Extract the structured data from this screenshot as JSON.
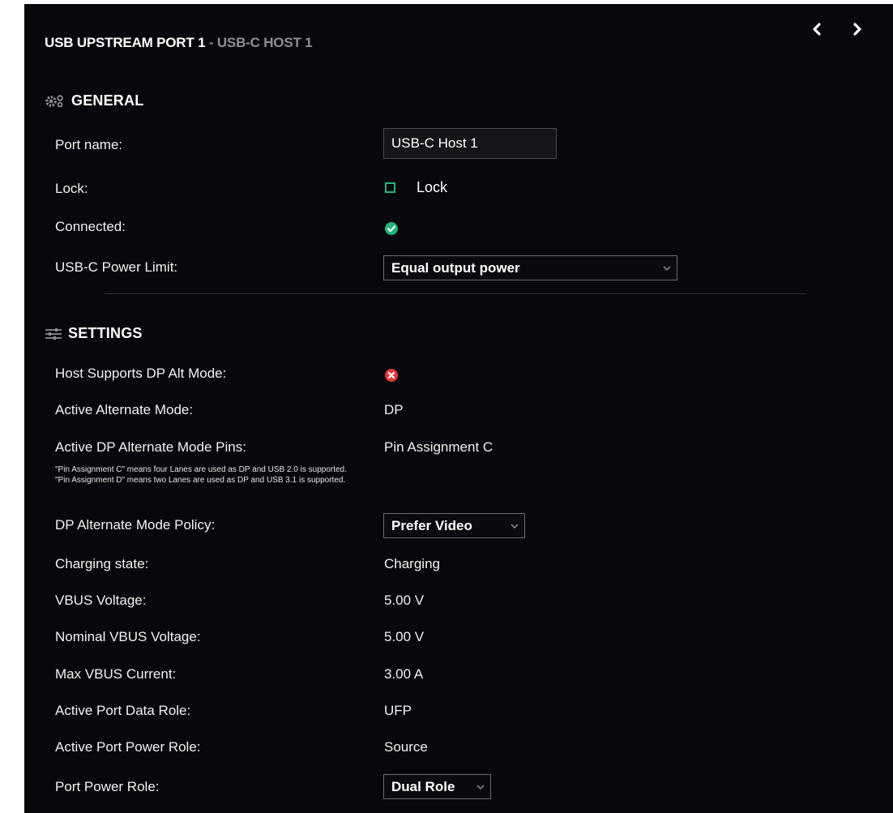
{
  "header": {
    "title": "USB UPSTREAM PORT 1",
    "separator": " - ",
    "subtitle": "USB-C HOST 1",
    "prev_icon": "chevron-left-icon",
    "next_icon": "chevron-right-icon"
  },
  "general": {
    "heading": "GENERAL",
    "icon": "gears-icon",
    "port_name_label": "Port name:",
    "port_name_value": "USB-C Host 1",
    "lock_label": "Lock:",
    "lock_checkbox_label": "Lock",
    "lock_checked": false,
    "connected_label": "Connected:",
    "connected_icon": "check-circle-icon",
    "power_limit_label": "USB-C Power Limit:",
    "power_limit_value": "Equal output power"
  },
  "settings": {
    "heading": "SETTINGS",
    "icon": "sliders-icon",
    "dp_alt_label": "Host Supports DP Alt Mode:",
    "dp_alt_icon": "x-circle-icon",
    "active_alt_label": "Active Alternate Mode:",
    "active_alt_value": "DP",
    "pins_label": "Active DP Alternate Mode Pins:",
    "pins_value": "Pin Assignment C",
    "note_1": "\"Pin Assignment C\" means four Lanes are used as DP and USB 2.0 is supported.",
    "note_2": "\"Pin Assignment D\" means two Lanes are used as DP and USB 3.1 is supported.",
    "policy_label": "DP Alternate Mode Policy:",
    "policy_value": "Prefer Video",
    "charging_label": "Charging state:",
    "charging_value": "Charging",
    "vbus_label": "VBUS Voltage:",
    "vbus_value": "5.00 V",
    "nominal_label": "Nominal VBUS Voltage:",
    "nominal_value": "5.00 V",
    "current_label": "Max VBUS Current:",
    "current_value": "3.00 A",
    "data_role_label": "Active Port Data Role:",
    "data_role_value": "UFP",
    "power_role_label": "Active Port Power Role:",
    "power_role_value": "Source",
    "port_power_label": "Port Power Role:",
    "port_power_value": "Dual Role"
  },
  "colors": {
    "panel_bg": "#07080d",
    "success": "#23b57a",
    "error": "#e5383b",
    "muted": "#8d8f94"
  }
}
